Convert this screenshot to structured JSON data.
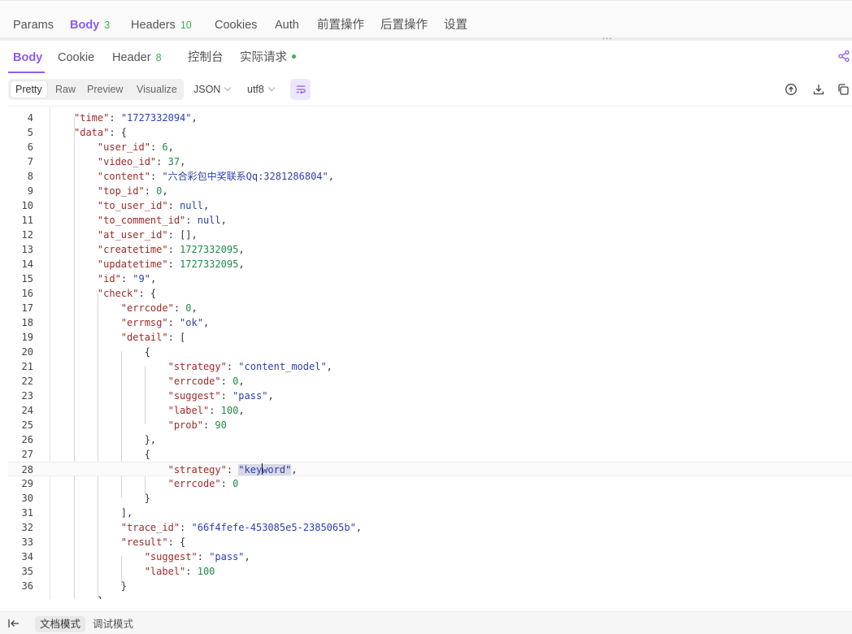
{
  "request_tabs": [
    {
      "label": "Params",
      "badge": ""
    },
    {
      "label": "Body",
      "badge": "3"
    },
    {
      "label": "Headers",
      "badge": "10"
    },
    {
      "label": "Cookies",
      "badge": ""
    },
    {
      "label": "Auth",
      "badge": ""
    },
    {
      "label": "前置操作",
      "badge": ""
    },
    {
      "label": "后置操作",
      "badge": ""
    },
    {
      "label": "设置",
      "badge": ""
    }
  ],
  "resize_grip": "...",
  "response_tabs": [
    {
      "label": "Body",
      "badge": ""
    },
    {
      "label": "Cookie",
      "badge": ""
    },
    {
      "label": "Header",
      "badge": "8"
    },
    {
      "label": "控制台",
      "badge": ""
    },
    {
      "label": "实际请求",
      "badge": ""
    }
  ],
  "toolbar": {
    "views": [
      "Pretty",
      "Raw",
      "Preview",
      "Visualize"
    ],
    "format": "JSON",
    "encoding": "utf8"
  },
  "editor": {
    "line_numbers": [
      "4",
      "5",
      "6",
      "7",
      "8",
      "9",
      "10",
      "11",
      "12",
      "13",
      "14",
      "15",
      "16",
      "17",
      "18",
      "19",
      "20",
      "21",
      "22",
      "23",
      "24",
      "25",
      "26",
      "27",
      "28",
      "29",
      "30",
      "31",
      "32",
      "33",
      "34",
      "35",
      "36"
    ],
    "values": {
      "time": "\"1727332094\"",
      "user_id": "6",
      "video_id": "37",
      "content": "\"六合彩包中奖联系Qq:3281286804\"",
      "top_id": "0",
      "null": "null",
      "empty_array": "[]",
      "createtime": "1727332095",
      "updatetime": "1727332095",
      "id": "\"9\"",
      "errcode_zero": "0",
      "errmsg": "\"ok\"",
      "strategy1": "\"content_model\"",
      "pass": "\"pass\"",
      "label": "100",
      "prob": "90",
      "strategy2_pre": "\"key",
      "strategy2_post": "word\"",
      "trace_id": "\"66f4fefe-453085e5-2385065b\""
    },
    "keys": {
      "time": "\"time\"",
      "data": "\"data\"",
      "user_id": "\"user_id\"",
      "video_id": "\"video_id\"",
      "content": "\"content\"",
      "top_id": "\"top_id\"",
      "to_user_id": "\"to_user_id\"",
      "to_comment_id": "\"to_comment_id\"",
      "at_user_id": "\"at_user_id\"",
      "createtime": "\"createtime\"",
      "updatetime": "\"updatetime\"",
      "id": "\"id\"",
      "check": "\"check\"",
      "errcode": "\"errcode\"",
      "errmsg": "\"errmsg\"",
      "detail": "\"detail\"",
      "strategy": "\"strategy\"",
      "suggest": "\"suggest\"",
      "label": "\"label\"",
      "prob": "\"prob\"",
      "trace_id": "\"trace_id\"",
      "result": "\"result\""
    }
  },
  "footer": {
    "modes": [
      "文档模式",
      "调试模式"
    ]
  },
  "colors": {
    "accent": "#8b5cf6",
    "badge_green": "#3fae55",
    "json_key": "#9c2b28",
    "json_string": "#2a3fb0",
    "json_number": "#1f8a4a"
  },
  "icons": [
    "share-icon",
    "upload-icon",
    "download-icon",
    "copy-icon",
    "wrap-lines-icon",
    "collapse-panel-icon"
  ]
}
